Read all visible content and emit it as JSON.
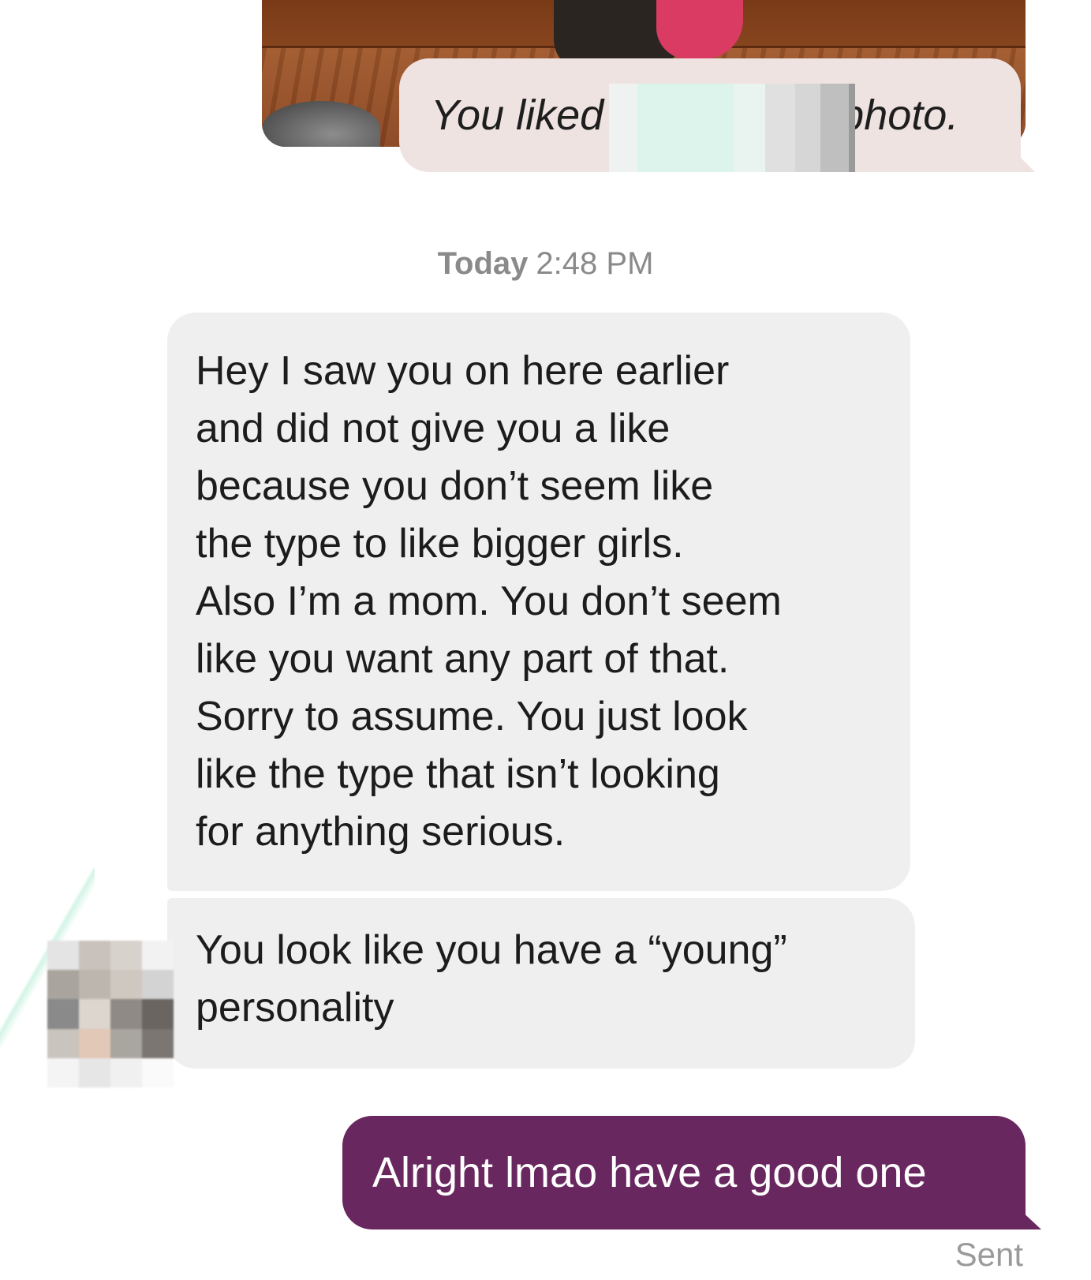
{
  "like_notice": {
    "prefix": "You liked",
    "suffix": "photo."
  },
  "timestamp": {
    "day": "Today",
    "time": "2:48 PM"
  },
  "messages": [
    {
      "direction": "received",
      "text": "Hey I saw you on here earlier\nand did not give you a like\nbecause you don’t seem like\nthe type to like bigger girls.\nAlso I’m a mom. You don’t seem\nlike you want any part of that.\nSorry to assume. You just look\nlike the type that isn’t looking\nfor anything serious."
    },
    {
      "direction": "received",
      "text": "You look like you have a “young”\npersonality"
    },
    {
      "direction": "sent",
      "text": "Alright lmao have a good one",
      "status": "Sent"
    }
  ],
  "colors": {
    "sent_bubble": "#69275f",
    "received_bubble": "#efefef",
    "like_bubble": "#efe3e2",
    "meta_text": "#8a8a8a"
  }
}
